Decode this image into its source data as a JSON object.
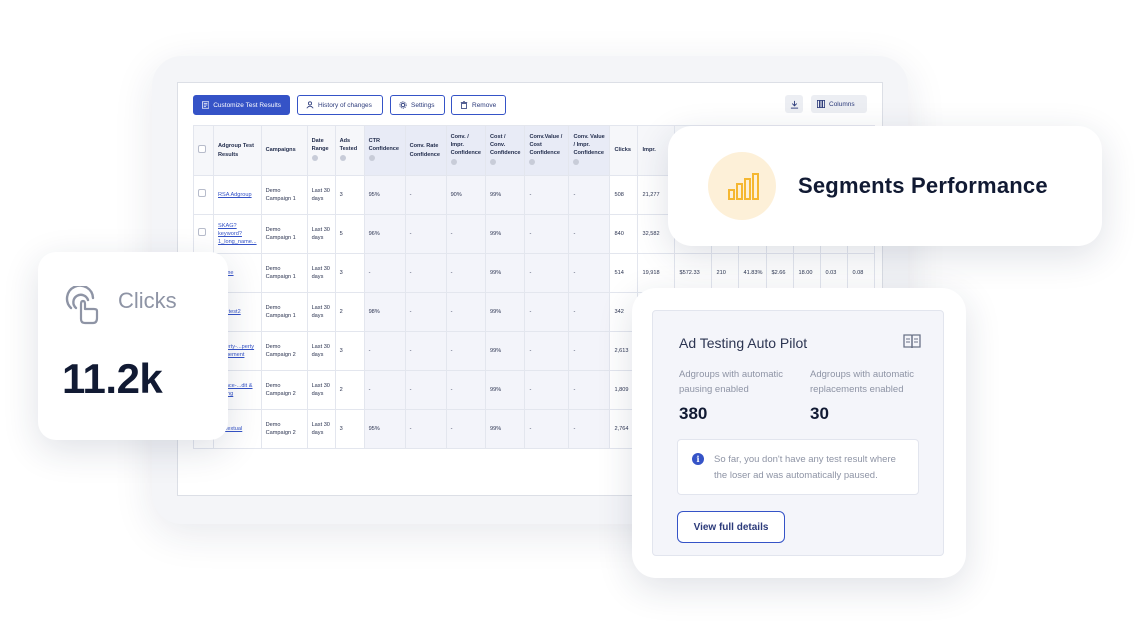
{
  "toolbar": {
    "customize_label": "Customize Test Results",
    "history_label": "History of changes",
    "settings_label": "Settings",
    "remove_label": "Remove",
    "columns_label": "Columns"
  },
  "table": {
    "headers": [
      "Adgroup Test Results",
      "Campaigns",
      "Date Range",
      "Ads Tested",
      "CTR Confidence",
      "Conv. Rate Confidence",
      "Conv. / Impr. Confidence",
      "Cost / Conv. Confidence",
      "Conv.Value / Cost Confidence",
      "Conv. Value / Impr. Confidence",
      "Clicks",
      "Impr."
    ],
    "extra_headers": [
      "",
      "",
      "",
      "",
      "",
      "",
      ""
    ],
    "rows": [
      {
        "adgroup": "RSA Adgroup",
        "campaign": "Demo Campaign 1",
        "range": "Last 30 days",
        "ads": "3",
        "ctr": "95%",
        "cr": "-",
        "ci": "90%",
        "cc": "99%",
        "cvc": "-",
        "cvi": "-",
        "clicks": "508",
        "impr": "21,277",
        "extra": [
          "",
          "",
          "",
          "",
          "",
          "",
          ""
        ]
      },
      {
        "adgroup": "SKAG? keyword?1_long_name...",
        "campaign": "Demo Campaign 1",
        "range": "Last 30 days",
        "ads": "5",
        "ctr": "96%",
        "cr": "-",
        "ci": "-",
        "cc": "99%",
        "cvc": "-",
        "cvi": "-",
        "clicks": "840",
        "impr": "32,582",
        "extra": [
          "",
          "",
          "",
          "",
          "",
          "",
          ""
        ]
      },
      {
        "adgroup": "...eme",
        "campaign": "Demo Campaign 1",
        "range": "Last 30 days",
        "ads": "3",
        "ctr": "-",
        "cr": "-",
        "ci": "-",
        "cc": "99%",
        "cvc": "-",
        "cvi": "-",
        "clicks": "514",
        "impr": "19,918",
        "extra": [
          "$572.33",
          "210",
          "41.83%",
          "$2.66",
          "18.00",
          "0.03",
          "0.08"
        ]
      },
      {
        "adgroup": "...G test2",
        "campaign": "Demo Campaign 1",
        "range": "Last 30 days",
        "ads": "2",
        "ctr": "98%",
        "cr": "-",
        "ci": "-",
        "cc": "99%",
        "cvc": "-",
        "cvi": "-",
        "clicks": "342",
        "impr": "",
        "extra": [
          "",
          "",
          "",
          "",
          "",
          "",
          ""
        ]
      },
      {
        "adgroup": "...perty-...perty ...agement",
        "campaign": "Demo Campaign 2",
        "range": "Last 30 days",
        "ads": "3",
        "ctr": "-",
        "cr": "-",
        "ci": "-",
        "cc": "99%",
        "cvc": "-",
        "cvi": "-",
        "clicks": "2,613",
        "impr": "",
        "extra": [
          "",
          "",
          "",
          "",
          "",
          "",
          ""
        ]
      },
      {
        "adgroup": "...ance-...dit & ...ding",
        "campaign": "Demo Campaign 2",
        "range": "Last 30 days",
        "ads": "2",
        "ctr": "-",
        "cr": "-",
        "ci": "-",
        "cc": "99%",
        "cvc": "-",
        "cvi": "-",
        "clicks": "1,809",
        "impr": "",
        "extra": [
          "",
          "",
          "",
          "",
          "",
          "",
          ""
        ]
      },
      {
        "adgroup": "...ntextual",
        "campaign": "Demo Campaign 2",
        "range": "Last 30 days",
        "ads": "3",
        "ctr": "95%",
        "cr": "-",
        "ci": "-",
        "cc": "99%",
        "cvc": "-",
        "cvi": "-",
        "clicks": "2,764",
        "impr": "",
        "extra": [
          "",
          "",
          "",
          "",
          "",
          "",
          ""
        ]
      }
    ]
  },
  "segments_card": {
    "title": "Segments Performance",
    "icon": "bar-chart-icon",
    "accent": "#f5b731"
  },
  "clicks_card": {
    "label": "Clicks",
    "value": "11.2k",
    "icon": "click-pointer-icon"
  },
  "autopilot": {
    "title": "Ad Testing Auto Pilot",
    "icon": "book-icon",
    "pausing_label": "Adgroups with automatic pausing enabled",
    "pausing_value": "380",
    "replacements_label": "Adgroups with automatic replacements enabled",
    "replacements_value": "30",
    "notice": "So far, you don't have any test result where the loser ad was automatically paused.",
    "details_button": "View full details"
  },
  "colors": {
    "primary": "#3553c7",
    "text_dark": "#111a33",
    "muted": "#8e94a5"
  }
}
